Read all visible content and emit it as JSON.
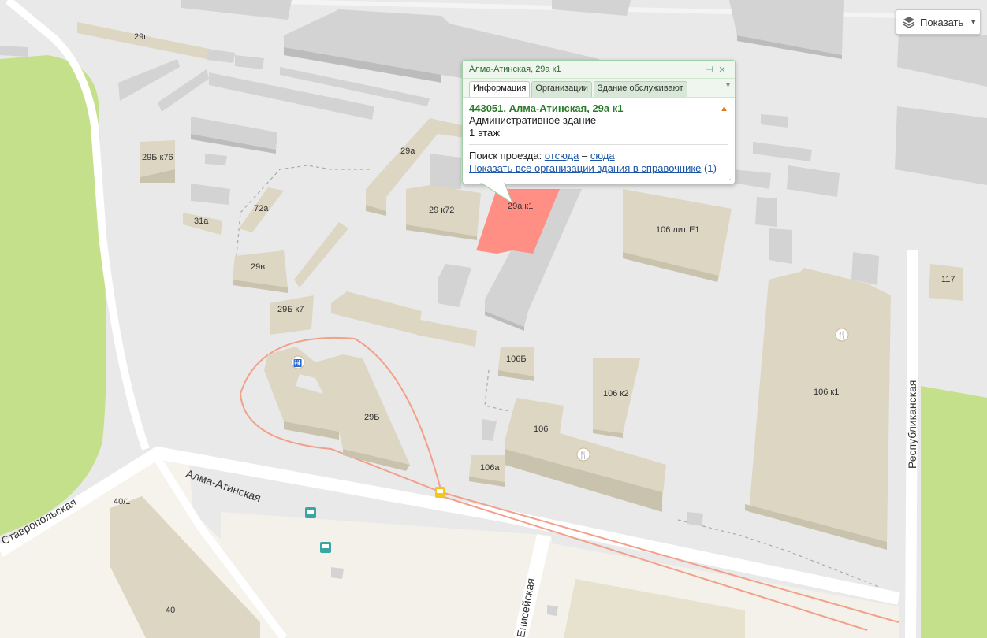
{
  "colors": {
    "land": "#e9e9e9",
    "park": "#c4e08a",
    "road": "#ffffff",
    "building_top": "#ddd6c3",
    "building_side": "#c9c2ad",
    "gray_top": "#d3d3d3",
    "gray_side": "#bcbcbc",
    "selected": "#ff8f85",
    "tram": "#f2a08a",
    "balloon_border": "#9fcfa4",
    "address_green": "#2b7a2b",
    "link_blue": "#1a55a8"
  },
  "controls": {
    "layers_label": "Показать",
    "layers_icon": "layers-icon",
    "caret_icon": "caret-down-icon"
  },
  "balloon": {
    "title": "Алма-Атинская, 29а к1",
    "pin_icon": "pin-icon",
    "close_icon": "close-icon",
    "tabs": [
      "Информация",
      "Организации",
      "Здание обслуживают"
    ],
    "active_tab": "Информация",
    "address": "443051, Алма-Атинская, 29а к1",
    "warning_icon": "warning-icon",
    "building_type": "Административное здание",
    "floors": "1 этаж",
    "route_prefix": "Поиск проезда:",
    "route_from": "отсюда",
    "route_dash": "–",
    "route_to": "сюда",
    "org_link": "Показать все организации здания в справочнике",
    "org_count": "(1)"
  },
  "streets": [
    "Алма-Атинская",
    "Ставропольская",
    "Енисейская",
    "Республиканская"
  ],
  "buildings": {
    "b29g": "29г",
    "b29b76": "29Б к76",
    "b72a": "72а",
    "b31a": "31а",
    "b29a": "29а",
    "b29k72": "29 к72",
    "b29ak1": "29а к1",
    "b29v": "29в",
    "b29b7": "29Б к7",
    "b106lit": "106 лит Е1",
    "b117": "117",
    "b106b": "106Б",
    "b106k2": "106 к2",
    "b29b": "29Б",
    "b106": "106",
    "b106a": "106а",
    "b106k1": "106 к1",
    "b40_1": "40/1",
    "b40": "40"
  },
  "icons": [
    "restaurant-icon",
    "toilet-icon",
    "tram-stop-icon",
    "bus-stop-icon"
  ]
}
